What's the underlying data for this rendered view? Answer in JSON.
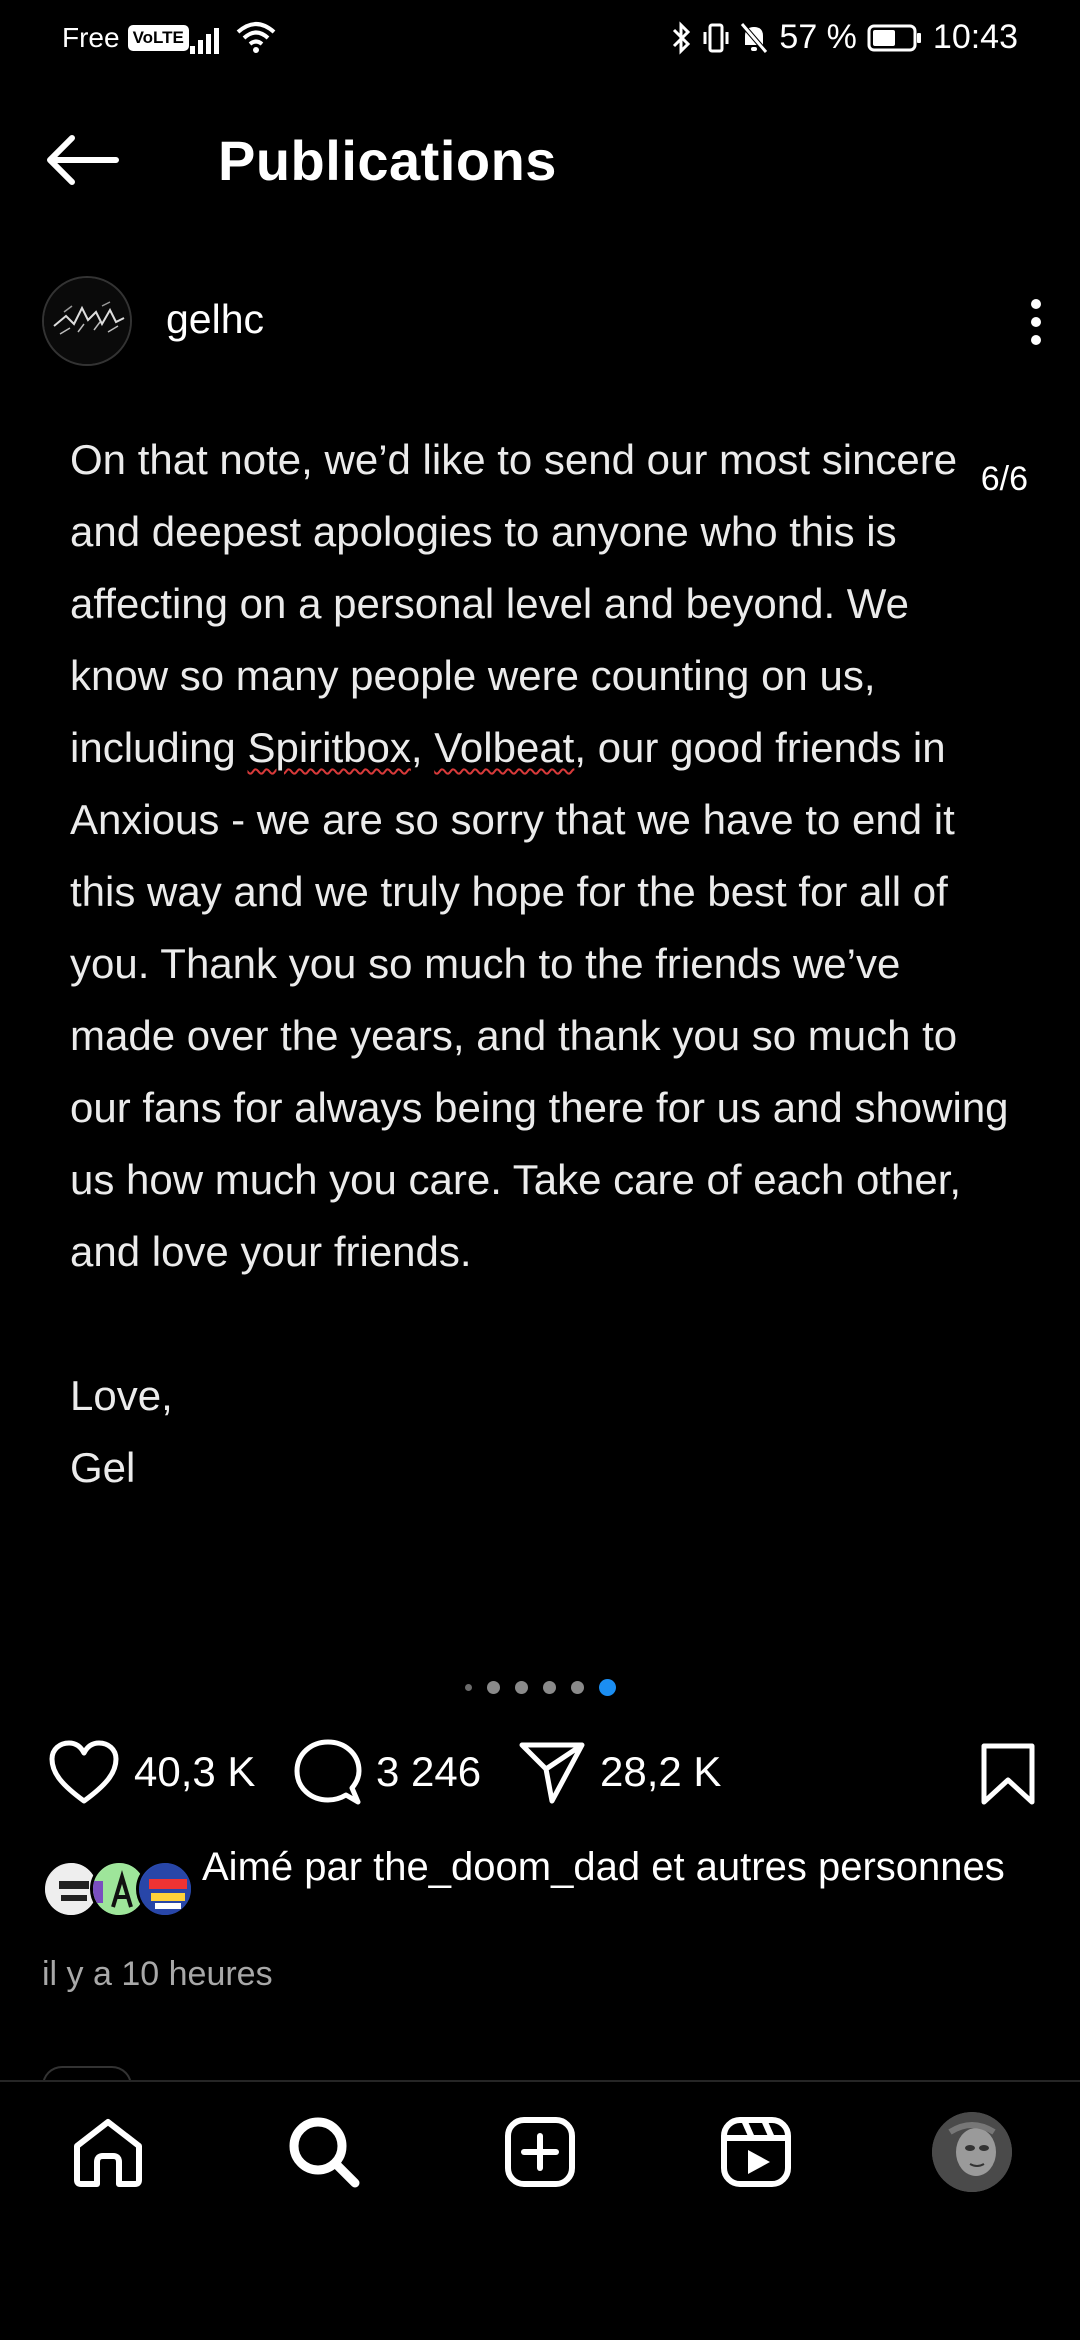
{
  "status_bar": {
    "carrier": "Free",
    "volte": "VoLTE",
    "battery_percent": "57 %",
    "battery_level": 0.57,
    "time": "10:43"
  },
  "header": {
    "title": "Publications",
    "back_icon": "arrow-left-icon"
  },
  "post": {
    "username": "gelhc",
    "slide_counter": "6/6",
    "slides_total": 6,
    "active_slide": 6,
    "text_parts": {
      "p1": "On that note, we’d like to send our most sincere and deepest apologies to anyone who this is affecting on a personal level and beyond. We know so many people were counting on us, including ",
      "spiritbox": "Spiritbox",
      "comma1": ", ",
      "volbeat": "Volbeat",
      "p2": ", our good friends in Anxious - we are so sorry that we have to end it this way and we truly hope for the best for all of you. Thank you so much to the friends we’ve made over the years, and thank you so much to our fans for always being there for us and showing us how much you care. Take care of each other, and love your friends.",
      "love": "Love,",
      "signature": "Gel"
    }
  },
  "actions": {
    "likes": "40,3 K",
    "comments": "3 246",
    "shares": "28,2 K",
    "icons": [
      "heart-icon",
      "comment-icon",
      "send-icon",
      "bookmark-icon"
    ]
  },
  "liked_by": {
    "prefix": "Aimé par ",
    "user": "the_doom_dad",
    "middle": " et ",
    "suffix": "autres personnes"
  },
  "timestamp": "il y a 10 heures",
  "bottom_nav": {
    "items": [
      "home-icon",
      "search-icon",
      "create-icon",
      "reels-icon",
      "profile-avatar"
    ]
  },
  "colors": {
    "background": "#000000",
    "accent": "#1b8ef2",
    "muted": "#a8a8a8"
  }
}
